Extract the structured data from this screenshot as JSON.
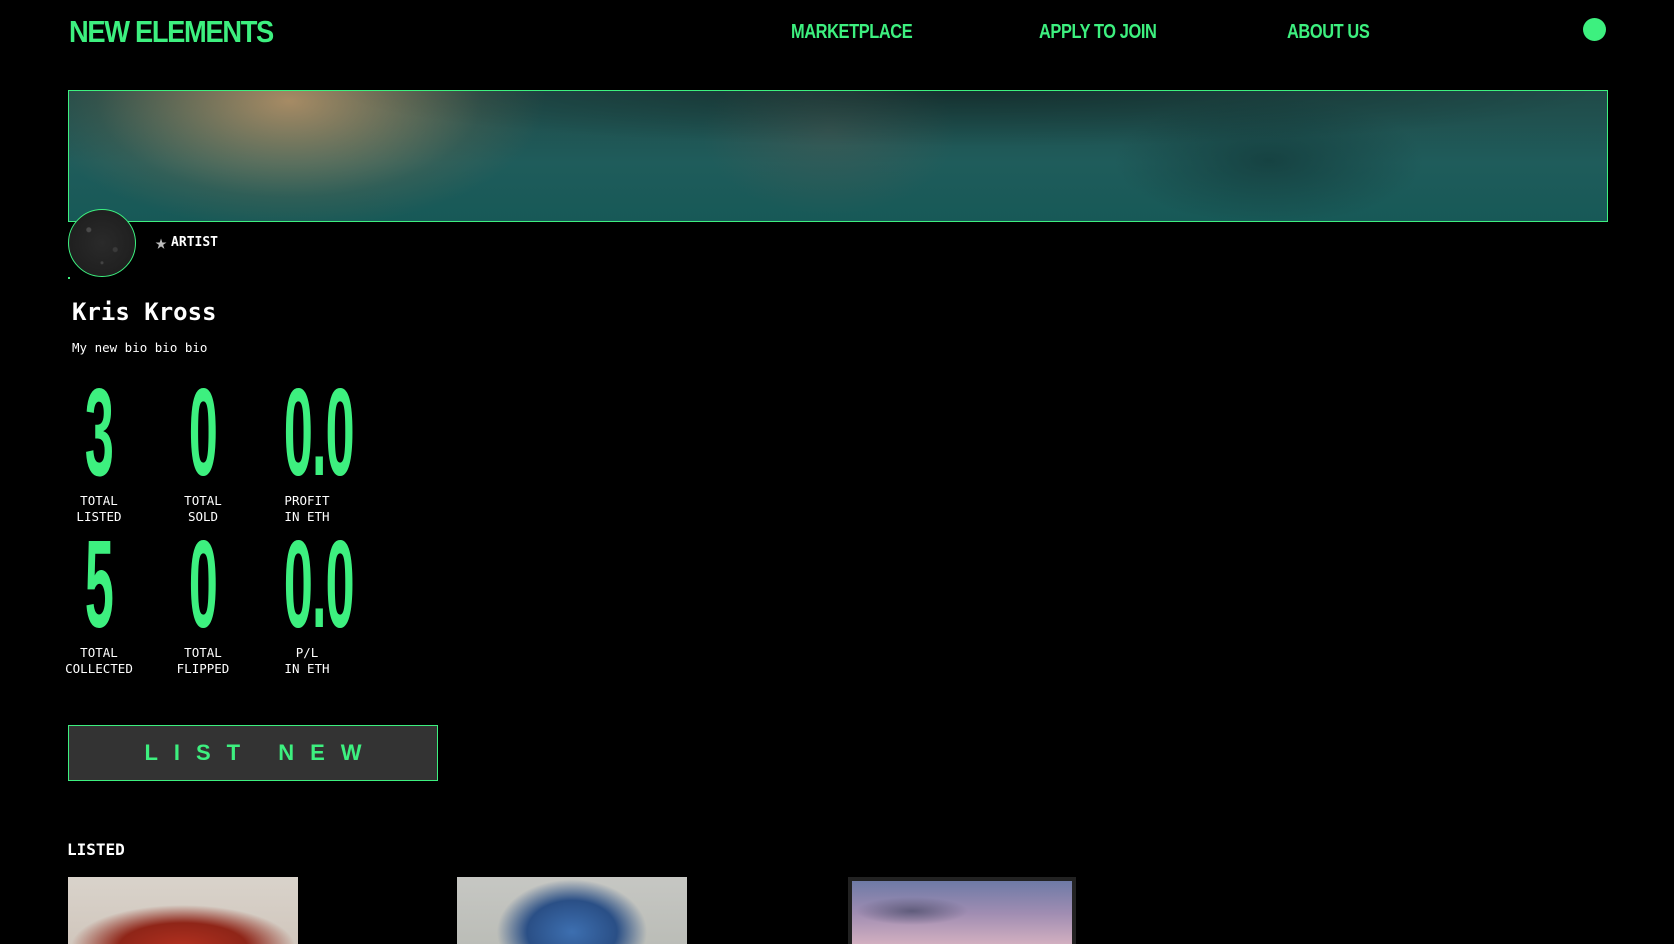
{
  "header": {
    "logo": "NEW ELEMENTS",
    "nav": {
      "marketplace": "MARKETPLACE",
      "apply": "APPLY TO JOIN",
      "about": "ABOUT US"
    }
  },
  "profile": {
    "badge_icon": "star-icon",
    "badge": "ARTIST",
    "name": "Kris Kross",
    "bio": "My new bio bio bio"
  },
  "stats": [
    {
      "value": "3",
      "label": "TOTAL\nLISTED"
    },
    {
      "value": "0",
      "label": "TOTAL\nSOLD"
    },
    {
      "value": "0.0",
      "label": "PROFIT\nIN ETH"
    },
    {
      "value": "5",
      "label": "TOTAL\nCOLLECTED"
    },
    {
      "value": "0",
      "label": "TOTAL\nFLIPPED"
    },
    {
      "value": "0.0",
      "label": "P/L\nIN ETH"
    }
  ],
  "actions": {
    "list_new": "LIST NEW"
  },
  "listed": {
    "title": "LISTED"
  },
  "colors": {
    "accent": "#3df07f",
    "background": "#000000",
    "button_bg": "#333333"
  }
}
